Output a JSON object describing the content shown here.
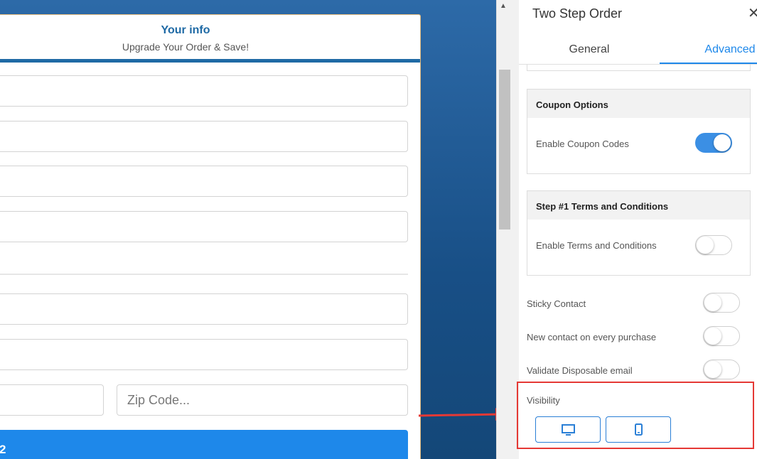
{
  "form": {
    "title": "Your info",
    "subtitle": "Upgrade Your Order & Save!",
    "zip_placeholder": "Zip Code...",
    "submit_label": "2"
  },
  "panel": {
    "title": "Two Step Order",
    "close_icon": "✕",
    "tabs": [
      {
        "label": "General",
        "active": false
      },
      {
        "label": "Advanced",
        "active": true
      }
    ],
    "coupon": {
      "header": "Coupon Options",
      "label": "Enable Coupon Codes",
      "enabled": true
    },
    "terms": {
      "header": "Step #1 Terms and Conditions",
      "label": "Enable Terms and Conditions",
      "enabled": false
    },
    "toggles": [
      {
        "label": "Sticky Contact",
        "enabled": false
      },
      {
        "label": "New contact on every purchase",
        "enabled": false
      },
      {
        "label": "Validate Disposable email",
        "enabled": false
      }
    ],
    "visibility": {
      "label": "Visibility",
      "options": [
        {
          "icon": "desktop-icon"
        },
        {
          "icon": "mobile-icon"
        }
      ]
    }
  },
  "colors": {
    "accent": "#1e88ea",
    "highlight": "#e53935",
    "header_blue": "#1f6aa5"
  }
}
